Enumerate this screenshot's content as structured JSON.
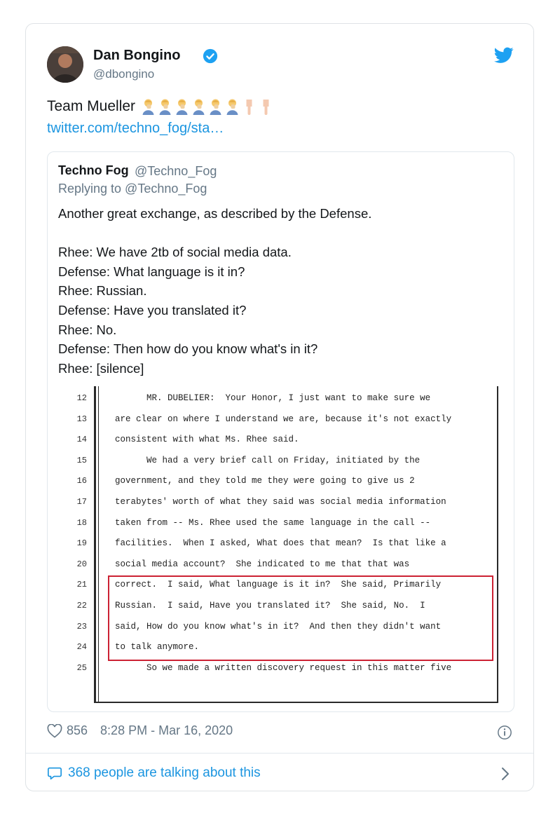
{
  "tweet": {
    "author_name": "Dan Bongino",
    "author_handle": "@dbongino",
    "text": "Team Mueller",
    "emojis": [
      "woman-facepalming-emoji",
      "woman-facepalming-emoji",
      "woman-facepalming-emoji",
      "woman-facepalming-emoji",
      "woman-facepalming-emoji",
      "woman-facepalming-emoji",
      "point-down-emoji",
      "point-down-emoji"
    ],
    "link": "twitter.com/techno_fog/sta…",
    "likes": "856",
    "timestamp": "8:28 PM - Mar 16, 2020",
    "talking": "368 people are talking about this"
  },
  "quote": {
    "author_name": "Techno Fog",
    "author_handle": "@Techno_Fog",
    "replying": "Replying to @Techno_Fog",
    "text": "Another great exchange, as described by the Defense.\n\nRhee: We have 2tb of social media data.\nDefense: What language is it in?\nRhee: Russian.\nDefense: Have you translated it?\nRhee: No.\nDefense: Then how do you know what's in it?\nRhee: [silence]"
  },
  "transcript": [
    {
      "num": "12",
      "text": "      MR. DUBELIER:  Your Honor, I just want to make sure we"
    },
    {
      "num": "13",
      "text": "are clear on where I understand we are, because it's not exactly"
    },
    {
      "num": "14",
      "text": "consistent with what Ms. Rhee said."
    },
    {
      "num": "15",
      "text": "      We had a very brief call on Friday, initiated by the"
    },
    {
      "num": "16",
      "text": "government, and they told me they were going to give us 2"
    },
    {
      "num": "17",
      "text": "terabytes' worth of what they said was social media information"
    },
    {
      "num": "18",
      "text": "taken from -- Ms. Rhee used the same language in the call --"
    },
    {
      "num": "19",
      "text": "facilities.  When I asked, What does that mean?  Is that like a"
    },
    {
      "num": "20",
      "text": "social media account?  She indicated to me that that was"
    },
    {
      "num": "21",
      "text": "correct.  I said, What language is it in?  She said, Primarily"
    },
    {
      "num": "22",
      "text": "Russian.  I said, Have you translated it?  She said, No.  I"
    },
    {
      "num": "23",
      "text": "said, How do you know what's in it?  And then they didn't want"
    },
    {
      "num": "24",
      "text": "to talk anymore."
    },
    {
      "num": "25",
      "text": "      So we made a written discovery request in this matter five"
    }
  ],
  "colors": {
    "accent": "#1b95e0",
    "text": "#14171a",
    "muted": "#657786",
    "highlight_box": "#cc2233"
  }
}
